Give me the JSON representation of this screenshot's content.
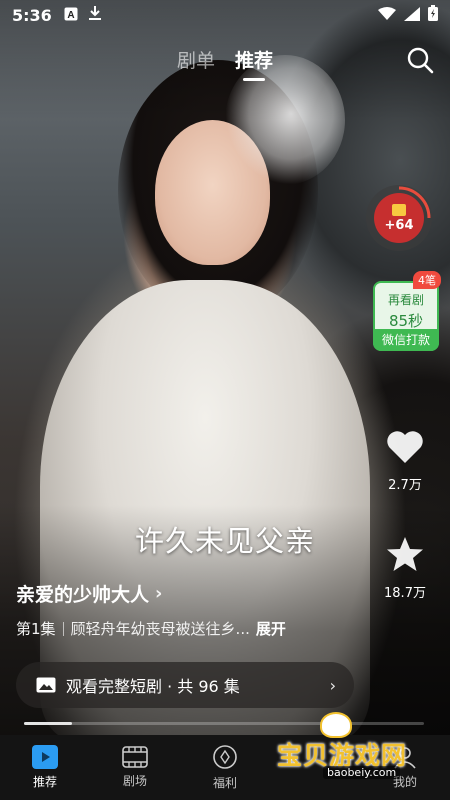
{
  "status_bar": {
    "time": "5:36",
    "left_icons": [
      "text-a-icon",
      "download-icon"
    ],
    "right_icons": [
      "wifi-icon",
      "signal-icon",
      "battery-icon"
    ]
  },
  "top_tabs": [
    {
      "label": "剧单",
      "active": false
    },
    {
      "label": "推荐",
      "active": true
    }
  ],
  "reward": {
    "value": "+64"
  },
  "earn_card": {
    "tag": "4笔",
    "line1": "再看剧",
    "line2": "85秒",
    "footer": "微信打款"
  },
  "actions": {
    "like_count": "2.7万",
    "favorite_count": "18.7万"
  },
  "video": {
    "subtitle": "许久未见父亲",
    "progress": 0.12
  },
  "show": {
    "title": "亲爱的少帅大人",
    "episode": "第1集",
    "description": "顾轻舟年幼丧母被送往乡...",
    "expand_label": "展开"
  },
  "watch_full": {
    "label": "观看完整短剧 · 共 96 集"
  },
  "bottom_nav": [
    {
      "label": "推荐",
      "icon": "play-icon",
      "active": true
    },
    {
      "label": "剧场",
      "icon": "film-icon",
      "active": false
    },
    {
      "label": "福利",
      "icon": "coin-icon",
      "active": false
    },
    {
      "label": "",
      "icon": "",
      "active": false
    },
    {
      "label": "我的",
      "icon": "profile-icon",
      "active": false
    }
  ],
  "watermark": {
    "text": "宝贝游戏网",
    "url": "baobeiy.com"
  },
  "colors": {
    "accent_blue": "#2b9cf2",
    "reward_red": "#c62f2f",
    "earn_green": "#3fb952",
    "tag_red": "#f04a3e",
    "watermark_yellow": "#f2c12e"
  }
}
